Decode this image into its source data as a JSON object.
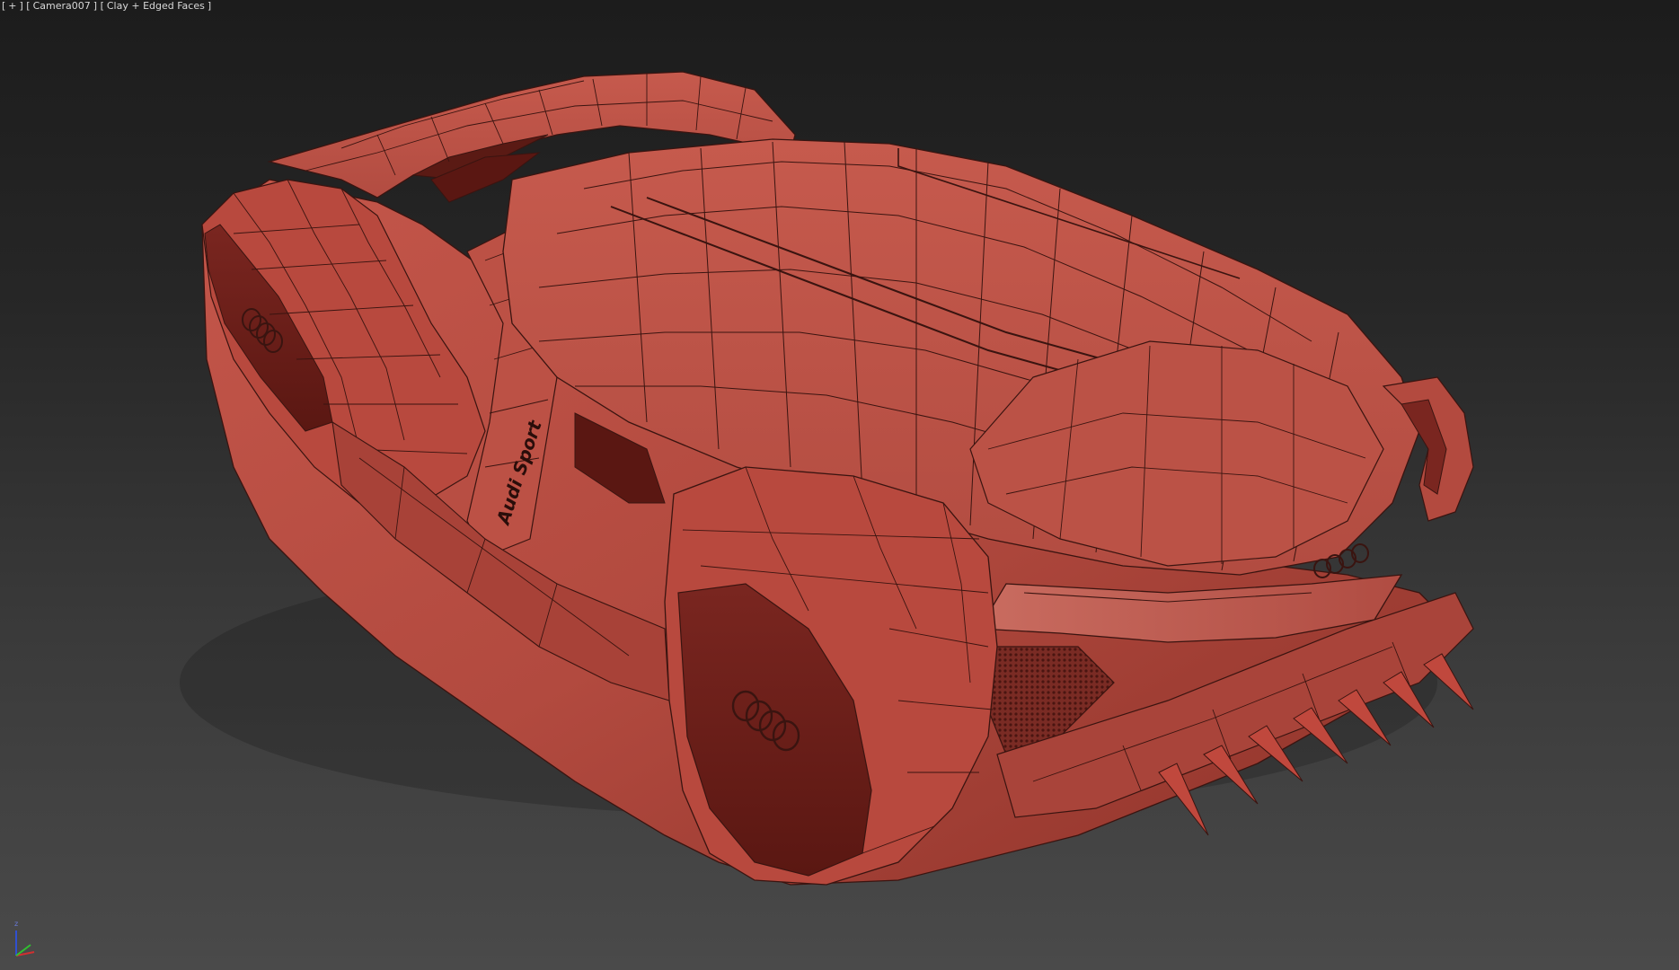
{
  "viewport": {
    "menu_label": "+",
    "camera_label": "Camera007",
    "shading_label": "Clay + Edged Faces"
  },
  "model": {
    "pillar_text": "Audi Sport",
    "body_color": "#b84a40",
    "edge_color": "#3a1410"
  },
  "gizmo": {
    "axis_z_label": "z",
    "axis_x_color": "#d03030",
    "axis_y_color": "#30c030",
    "axis_z_color": "#3050d0"
  }
}
